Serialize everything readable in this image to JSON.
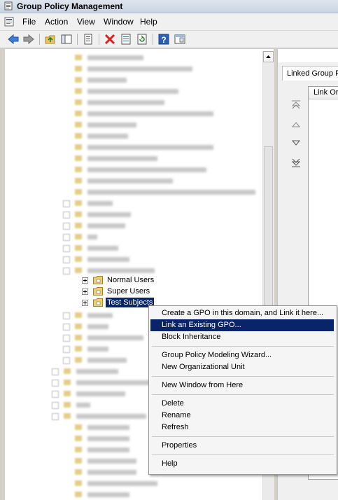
{
  "window": {
    "title": "Group Policy Management"
  },
  "menubar": {
    "items": [
      "File",
      "Action",
      "View",
      "Window",
      "Help"
    ]
  },
  "toolbar": {
    "icons": [
      "back-arrow-icon",
      "forward-arrow-icon",
      "up-folder-icon",
      "show-hide-tree-icon",
      "properties-icon",
      "delete-icon",
      "export-list-icon",
      "refresh-icon",
      "help-icon",
      "console-view-icon"
    ]
  },
  "tree": {
    "nodes": [
      {
        "label": "Normal Users",
        "selected": false
      },
      {
        "label": "Super Users",
        "selected": false
      },
      {
        "label": "Test Subjects",
        "selected": true
      }
    ]
  },
  "right_pane": {
    "tab_label": "Linked Group P",
    "column_header": "Link Or"
  },
  "context_menu": {
    "items": [
      {
        "label": "Create a GPO in this domain, and Link it here...",
        "highlighted": false
      },
      {
        "label": "Link an Existing GPO...",
        "highlighted": true
      },
      {
        "label": "Block Inheritance",
        "highlighted": false
      },
      {
        "label": "Group Policy Modeling Wizard...",
        "highlighted": false
      },
      {
        "label": "New Organizational Unit",
        "highlighted": false
      },
      {
        "label": "New Window from Here",
        "highlighted": false
      },
      {
        "label": "Delete",
        "highlighted": false
      },
      {
        "label": "Rename",
        "highlighted": false
      },
      {
        "label": "Refresh",
        "highlighted": false
      },
      {
        "label": "Properties",
        "highlighted": false
      },
      {
        "label": "Help",
        "highlighted": false
      }
    ]
  },
  "colors": {
    "selection": "#0a246a",
    "folder": "#e8c560"
  }
}
